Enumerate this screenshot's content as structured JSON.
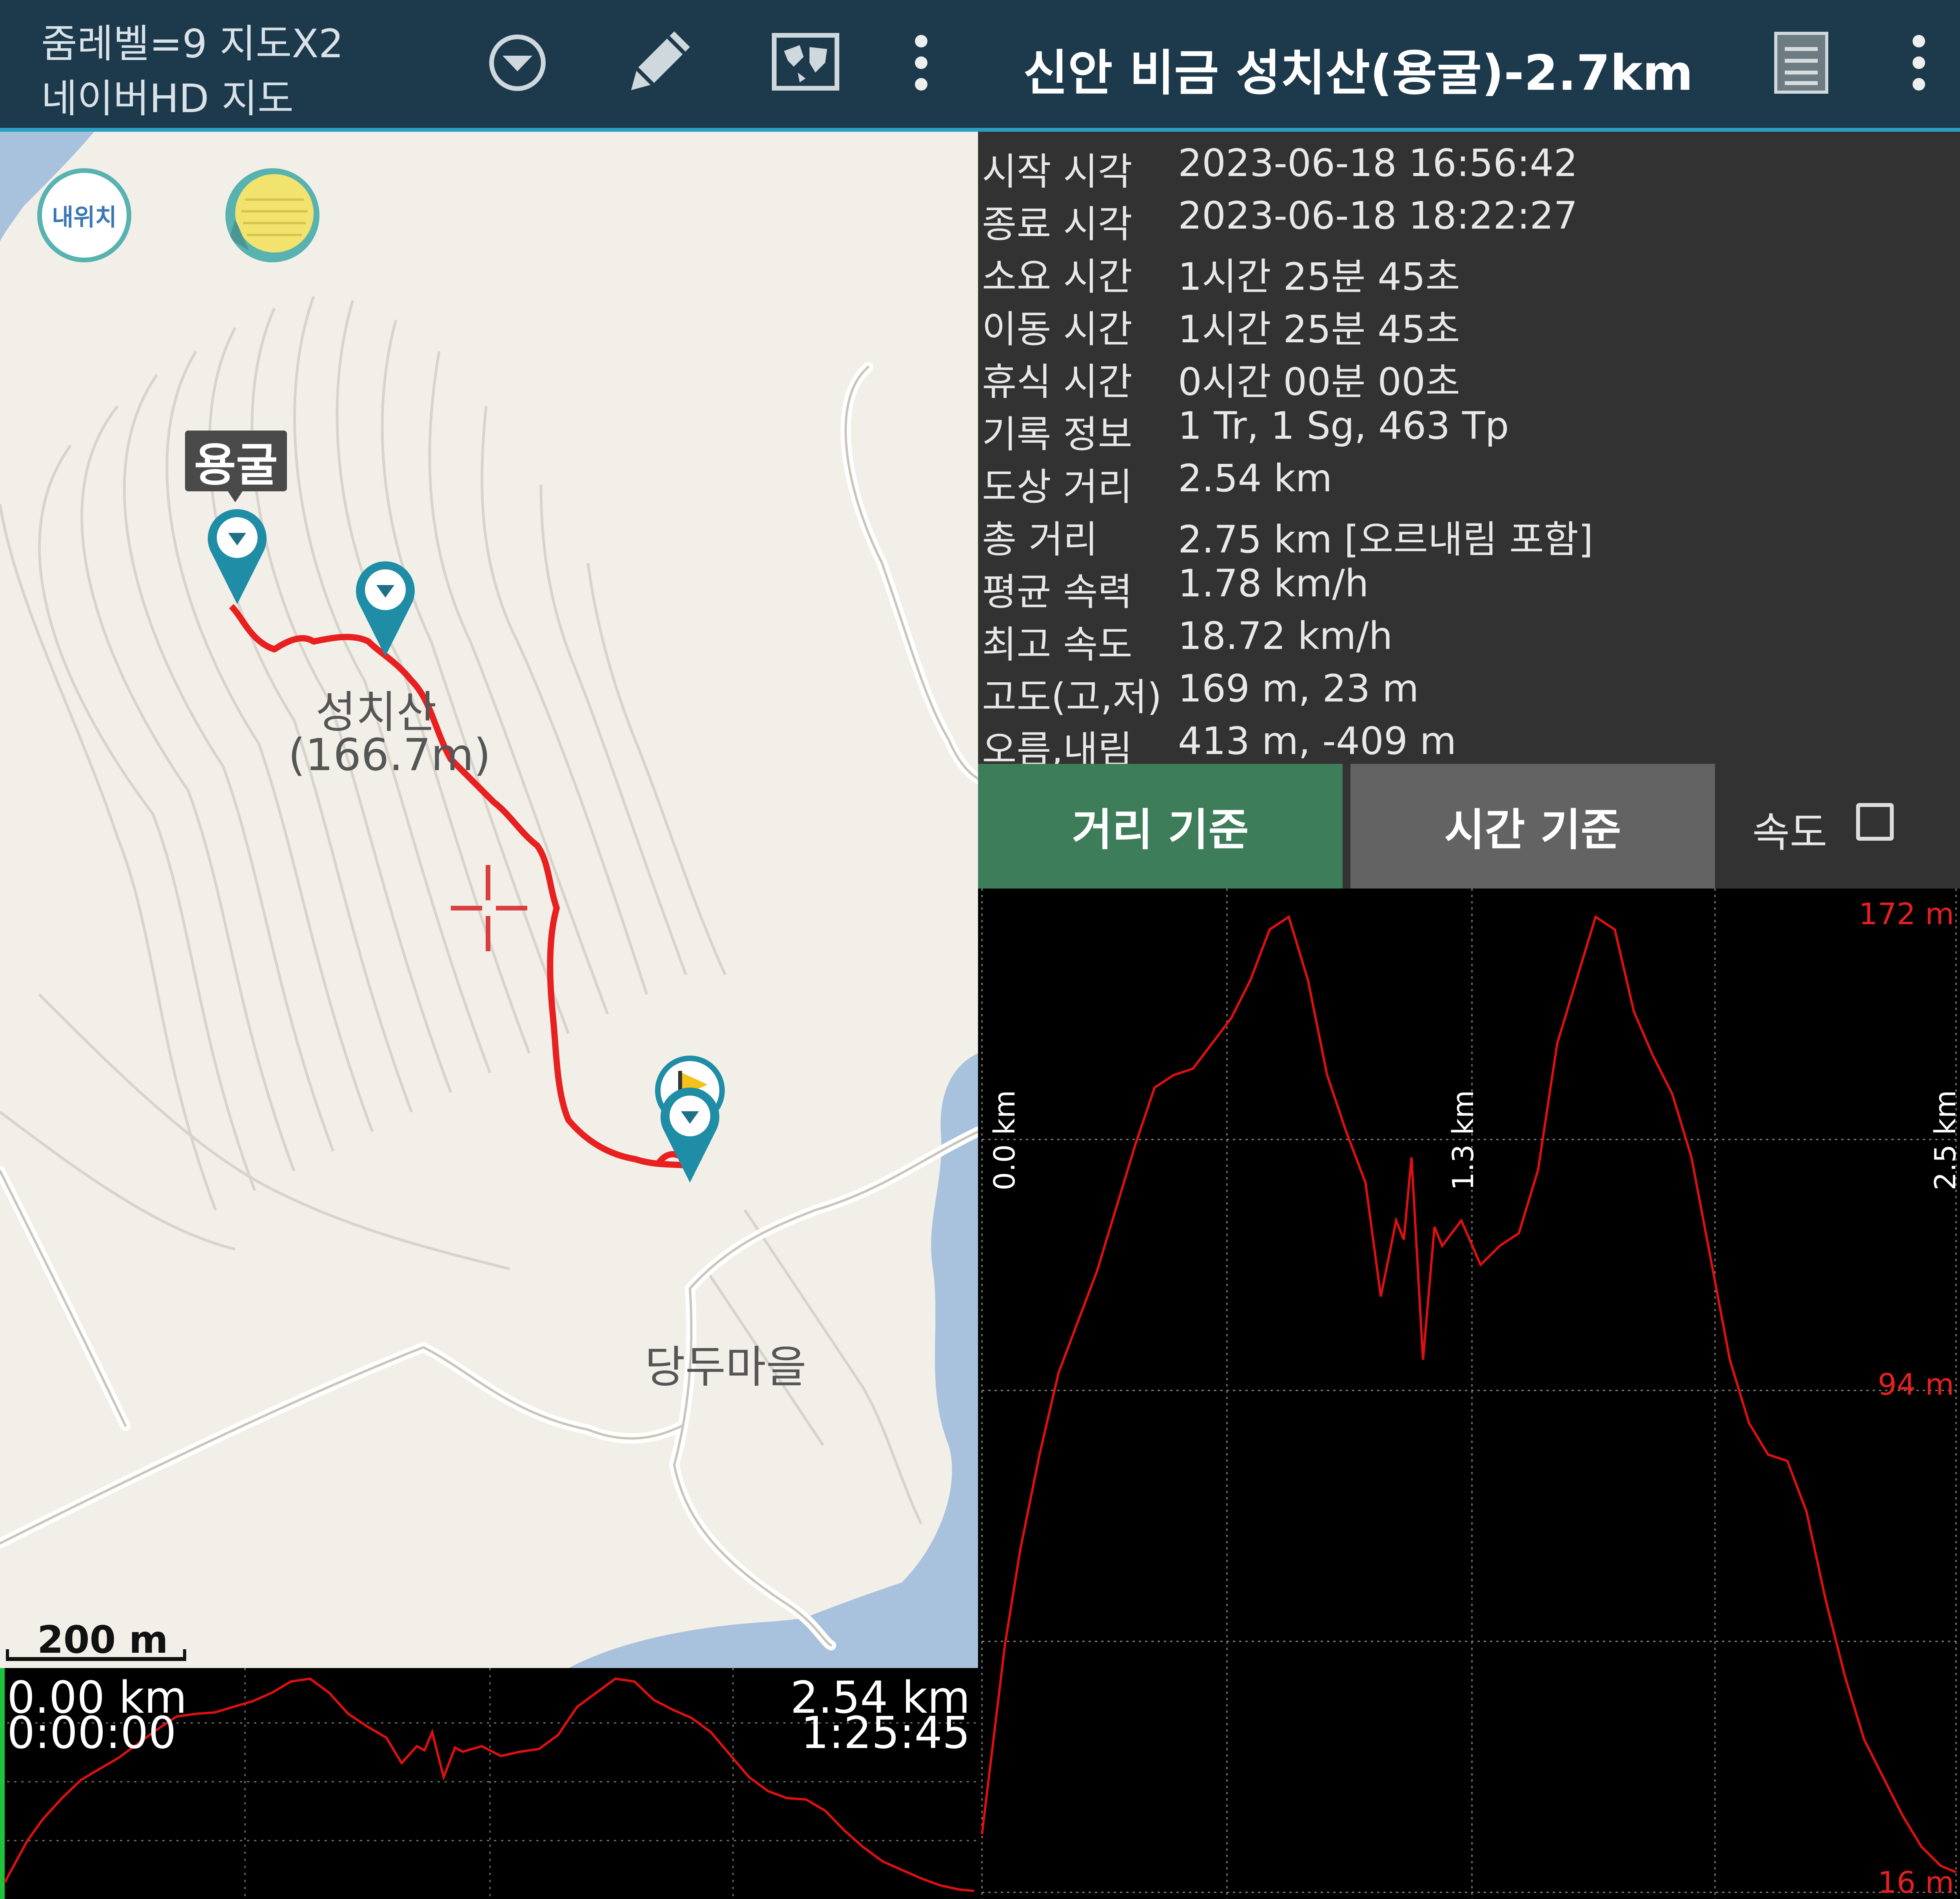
{
  "toolbar": {
    "zoom_text": "줌레벨=9 지도X2",
    "map_source": "네이버HD 지도",
    "track_title": "신안 비금 성치산(용굴)-2.7km",
    "icons": [
      "dropdown-circle-icon",
      "pencil-icon",
      "world-map-icon",
      "more-vert-icon",
      "list-icon",
      "more-vert-icon"
    ]
  },
  "map": {
    "my_location_label": "내위치",
    "waypoint_label": "용굴",
    "peak_name": "성치산",
    "peak_elevation": "(166.7m)",
    "village_name": "당두마을",
    "scale_label": "200 m"
  },
  "mini_profile": {
    "start_distance": "0.00 km",
    "start_time": "0:00:00",
    "end_distance": "2.54 km",
    "end_time": "1:25:45"
  },
  "stats": [
    {
      "label": "시작 시각",
      "value": "2023-06-18 16:56:42"
    },
    {
      "label": "종료 시각",
      "value": "2023-06-18 18:22:27"
    },
    {
      "label": "소요 시간",
      "value": "1시간 25분 45초"
    },
    {
      "label": "이동 시간",
      "value": "1시간 25분 45초"
    },
    {
      "label": "휴식 시간",
      "value": "0시간 00분 00초"
    },
    {
      "label": "기록 정보",
      "value": "1 Tr, 1 Sg, 463 Tp"
    },
    {
      "label": "도상 거리",
      "value": "2.54 km"
    },
    {
      "label": "총 거리",
      "value": "2.75 km [오르내림 포함]"
    },
    {
      "label": "평균 속력",
      "value": "1.78 km/h"
    },
    {
      "label": "최고 속도",
      "value": "18.72 km/h"
    },
    {
      "label": "고도(고,저)",
      "value": "169 m, 23 m"
    },
    {
      "label": "오름,내림",
      "value": "413 m, -409 m"
    }
  ],
  "tabs": {
    "distance_tab": "거리 기준",
    "time_tab": "시간 기준",
    "speed_label": "속도",
    "speed_checked": false,
    "active_color": "#3d7d5a",
    "inactive_color": "#636363"
  },
  "chart_data": {
    "type": "line",
    "x_unit": "km",
    "y_unit": "m",
    "y_tick_labels": [
      "172 m",
      "94 m",
      "16 m"
    ],
    "x_tick_labels": [
      "0.0 km",
      "1.3 km",
      "2.5 km"
    ],
    "xlim": [
      0,
      2.54
    ],
    "ylim": [
      16,
      172
    ],
    "grid": true,
    "line_color": "#e01010",
    "series": [
      {
        "x": [
          0.0,
          0.03,
          0.06,
          0.1,
          0.15,
          0.2,
          0.25,
          0.3,
          0.35,
          0.4,
          0.45,
          0.5,
          0.55,
          0.6,
          0.65,
          0.7,
          0.75,
          0.8,
          0.85,
          0.9,
          0.95,
          1.0,
          1.04,
          1.08,
          1.1,
          1.12,
          1.15,
          1.18,
          1.2,
          1.25,
          1.3,
          1.35,
          1.4,
          1.45,
          1.5,
          1.55,
          1.6,
          1.65,
          1.7,
          1.75,
          1.8,
          1.85,
          1.9,
          1.95,
          2.0,
          2.05,
          2.1,
          2.15,
          2.2,
          2.25,
          2.3,
          2.35,
          2.4,
          2.45,
          2.5,
          2.54
        ],
        "y": [
          25,
          40,
          55,
          70,
          85,
          98,
          106,
          114,
          124,
          134,
          143,
          145,
          146,
          150,
          154,
          160,
          168,
          170,
          160,
          145,
          136,
          128,
          110,
          122,
          119,
          132,
          100,
          121,
          118,
          122,
          115,
          118,
          120,
          130,
          150,
          160,
          170,
          168,
          155,
          148,
          142,
          132,
          116,
          100,
          90,
          85,
          84,
          76,
          62,
          50,
          40,
          34,
          28,
          23,
          20,
          19
        ]
      }
    ]
  }
}
